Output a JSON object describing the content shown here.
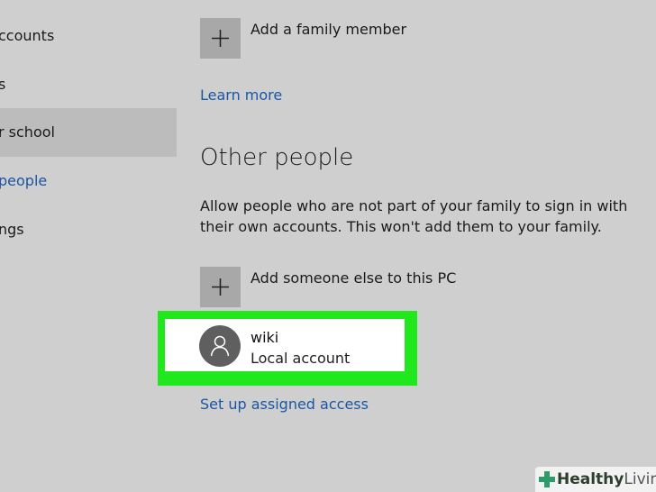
{
  "sidebar": {
    "items": [
      {
        "label": "ccounts"
      },
      {
        "label": "s"
      },
      {
        "label": "r school"
      },
      {
        "label": "people"
      },
      {
        "label": "ngs"
      }
    ]
  },
  "family": {
    "add_label": "Add a family member",
    "learn_more": "Learn more"
  },
  "other_people": {
    "heading": "Other people",
    "description": "Allow people who are not part of your family to sign in with their own accounts. This won't add them to your family.",
    "add_label": "Add someone else to this PC",
    "account": {
      "name": "wiki",
      "type": "Local account"
    },
    "assigned_access": "Set up assigned access"
  },
  "watermark": {
    "brand_bold": "Healthy",
    "brand_light": "Living"
  },
  "colors": {
    "background": "#cfcfcf",
    "link": "#1b56a5",
    "highlight": "#21e81c",
    "tile": "#a8a8a8"
  }
}
